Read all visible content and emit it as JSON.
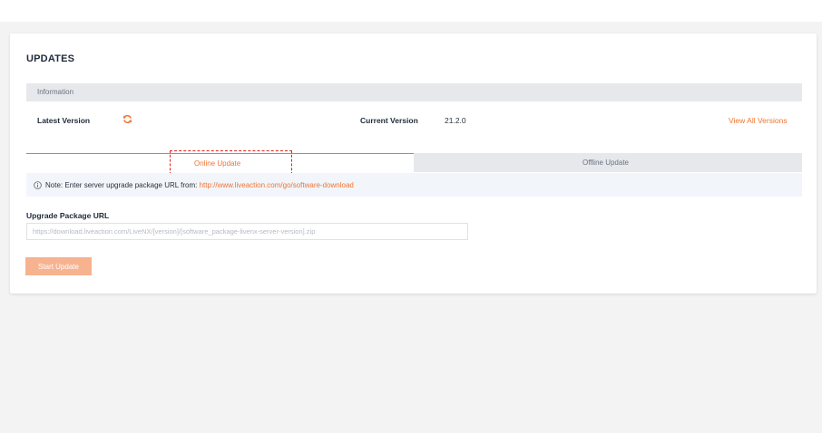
{
  "page": {
    "title": "UPDATES"
  },
  "information": {
    "section_label": "Information",
    "latest_version_label": "Latest Version",
    "current_version_label": "Current Version",
    "current_version_value": "21.2.0",
    "view_all_link": "View All Versions",
    "refresh_icon": "refresh-icon"
  },
  "tabs": {
    "online_label": "Online Update",
    "offline_label": "Offline Update",
    "active": "online"
  },
  "note": {
    "icon": "info-circle-icon",
    "text": "Note: Enter server upgrade package URL from:",
    "link": "http://www.liveaction.com/go/software-download"
  },
  "form": {
    "url_label": "Upgrade Package URL",
    "url_value": "",
    "url_placeholder": "https://download.liveaction.com/LiveNX/[version]/[software_package-livenx-server-version].zip",
    "start_button_label": "Start Update"
  },
  "colors": {
    "accent": "#f07533",
    "accent_disabled": "#f7b28f",
    "highlight": "#e02020",
    "section_bg": "#e6e8ec"
  }
}
